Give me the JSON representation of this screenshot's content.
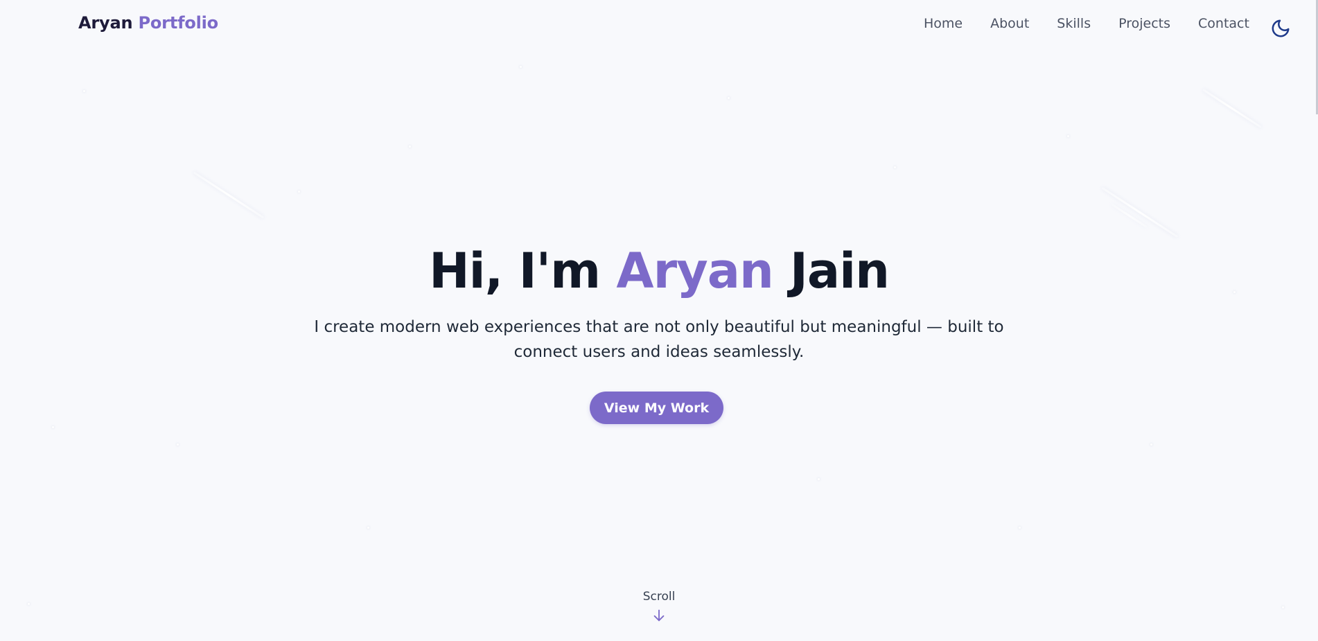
{
  "brand": {
    "first": "Aryan",
    "second": "Portfolio"
  },
  "nav": {
    "items": [
      {
        "label": "Home"
      },
      {
        "label": "About"
      },
      {
        "label": "Skills"
      },
      {
        "label": "Projects"
      },
      {
        "label": "Contact"
      }
    ],
    "theme_toggle_icon": "moon-icon"
  },
  "hero": {
    "greeting": "Hi, I'm",
    "first_name": "Aryan",
    "last_name": "Jain",
    "subtitle": "I create modern web experiences that are not only beautiful but meaningful — built to connect users and ideas seamlessly.",
    "cta_label": "View My Work"
  },
  "scroll": {
    "label": "Scroll",
    "icon": "arrow-down-icon"
  },
  "colors": {
    "accent": "#7c6ac9",
    "background": "#f8f9fc",
    "text_dark": "#111827",
    "nav_text": "#4b5263",
    "toggle_icon": "#1e3a8a"
  }
}
